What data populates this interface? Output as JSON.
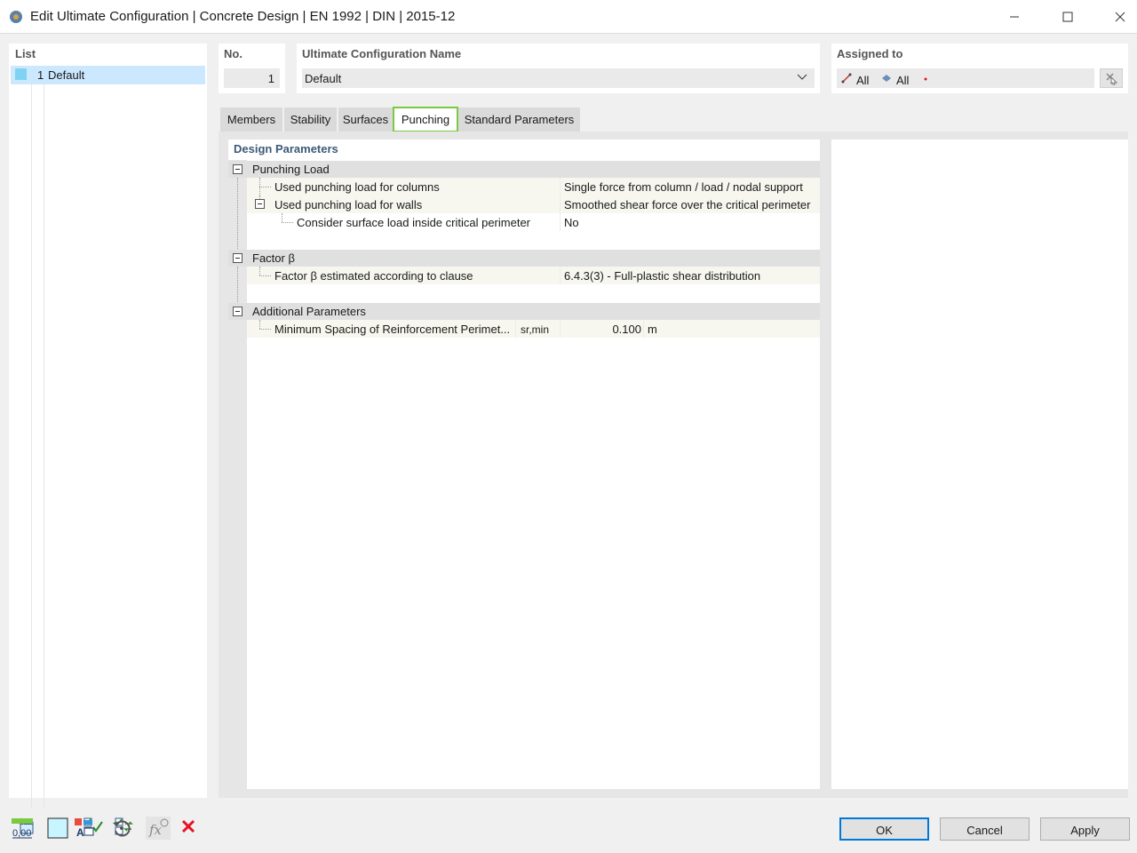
{
  "window": {
    "title": "Edit Ultimate Configuration | Concrete Design | EN 1992 | DIN | 2015-12"
  },
  "list": {
    "header": "List",
    "items": [
      {
        "number": "1",
        "name": "Default",
        "color": "#7fd2f2"
      }
    ]
  },
  "number": {
    "header": "No.",
    "value": "1"
  },
  "config_name": {
    "header": "Ultimate Configuration Name",
    "value": "Default"
  },
  "assigned": {
    "header": "Assigned to",
    "members_label": "All",
    "surfaces_label": "All"
  },
  "tabs": [
    {
      "label": "Members"
    },
    {
      "label": "Stability"
    },
    {
      "label": "Surfaces"
    },
    {
      "label": "Punching",
      "active": true
    },
    {
      "label": "Standard Parameters"
    }
  ],
  "design_parameters": {
    "header": "Design Parameters",
    "groups": [
      {
        "label": "Punching Load",
        "rows": [
          {
            "label": "Used punching load for columns",
            "value": "Single force from column / load / nodal support"
          },
          {
            "label": "Used punching load for walls",
            "value": "Smoothed shear force over the critical perimeter"
          },
          {
            "label": "Consider surface load inside critical perimeter",
            "value": "No"
          }
        ]
      },
      {
        "label": "Factor β",
        "rows": [
          {
            "label": "Factor β estimated according to clause",
            "value": "6.4.3(3) - Full-plastic shear distribution"
          }
        ]
      },
      {
        "label": "Additional Parameters",
        "rows": [
          {
            "label": "Minimum Spacing of Reinforcement Perimet...",
            "symbol": "sr,min",
            "value": "0.100",
            "unit": "m"
          }
        ]
      }
    ]
  },
  "buttons": {
    "ok": "OK",
    "cancel": "Cancel",
    "apply": "Apply"
  },
  "colors": {
    "accent_tab": "#7ac943",
    "primary_button_border": "#0078d7",
    "delete_icon": "#e81123"
  }
}
